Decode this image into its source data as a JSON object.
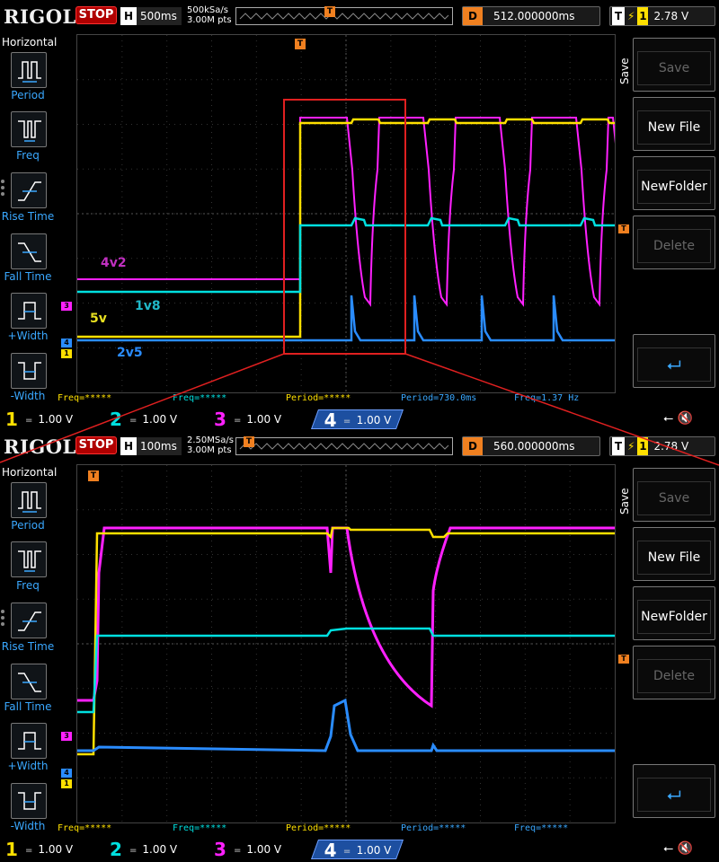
{
  "screens": [
    {
      "brand": "RIGOL",
      "run_state": "STOP",
      "timebase": {
        "key": "H",
        "value": "500ms"
      },
      "sample_rate": "500kSa/s",
      "memory_depth": "3.00M pts",
      "delay": {
        "key": "D",
        "value": "512.000000ms"
      },
      "trigger": {
        "key": "T",
        "source": "1",
        "level": "2.78 V"
      },
      "menu_title": "Horizontal",
      "left_menu": [
        "Period",
        "Freq",
        "Rise Time",
        "Fall Time",
        "+Width",
        "-Width"
      ],
      "right_title": "Save",
      "right_menu": [
        "Save",
        "New File",
        "NewFolder",
        "Delete"
      ],
      "labels": {
        "4v2": "4v2",
        "1v8": "1v8",
        "5v": "5v",
        "2v5": "2v5"
      },
      "measurements": [
        {
          "text": "Freq=*****",
          "color": "#ffe000"
        },
        {
          "text": "Freq=*****",
          "color": "#00e0e0"
        },
        {
          "text": "Period=*****",
          "color": "#ffe000"
        },
        {
          "text": "Period=730.0ms",
          "color": "#3aa8ff"
        },
        {
          "text": "Freq=1.37 Hz",
          "color": "#3aa8ff"
        }
      ],
      "channels": [
        {
          "num": "1",
          "value": "1.00 V",
          "color": "#ffe000"
        },
        {
          "num": "2",
          "value": "1.00 V",
          "color": "#00e0e0"
        },
        {
          "num": "3",
          "value": "1.00 V",
          "color": "#ff20ff"
        },
        {
          "num": "4",
          "value": "1.00 V",
          "color": "#3aa8ff"
        }
      ]
    },
    {
      "brand": "RIGOL",
      "run_state": "STOP",
      "timebase": {
        "key": "H",
        "value": "100ms"
      },
      "sample_rate": "2.50MSa/s",
      "memory_depth": "3.00M pts",
      "delay": {
        "key": "D",
        "value": "560.000000ms"
      },
      "trigger": {
        "key": "T",
        "source": "1",
        "level": "2.78 V"
      },
      "menu_title": "Horizontal",
      "left_menu": [
        "Period",
        "Freq",
        "Rise Time",
        "Fall Time",
        "+Width",
        "-Width"
      ],
      "right_title": "Save",
      "right_menu": [
        "Save",
        "New File",
        "NewFolder",
        "Delete"
      ],
      "measurements": [
        {
          "text": "Freq=*****",
          "color": "#ffe000"
        },
        {
          "text": "Freq=*****",
          "color": "#00e0e0"
        },
        {
          "text": "Period=*****",
          "color": "#ffe000"
        },
        {
          "text": "Period=*****",
          "color": "#3aa8ff"
        },
        {
          "text": "Freq=*****",
          "color": "#3aa8ff"
        }
      ],
      "channels": [
        {
          "num": "1",
          "value": "1.00 V",
          "color": "#ffe000"
        },
        {
          "num": "2",
          "value": "1.00 V",
          "color": "#00e0e0"
        },
        {
          "num": "3",
          "value": "1.00 V",
          "color": "#ff20ff"
        },
        {
          "num": "4",
          "value": "1.00 V",
          "color": "#3aa8ff"
        }
      ]
    }
  ],
  "colors": {
    "ch1": "#ffe000",
    "ch2": "#00e0e0",
    "ch3": "#ff20ff",
    "ch4": "#2a8cff",
    "trigger": "#f08020",
    "zoom_box": "#e02020"
  }
}
